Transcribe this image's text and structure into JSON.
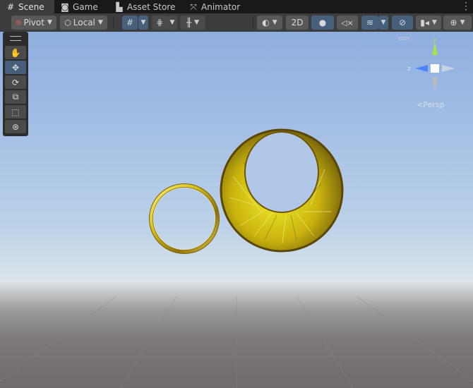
{
  "tabs": [
    {
      "label": "Scene",
      "icon": "grid-icon",
      "active": true
    },
    {
      "label": "Game",
      "icon": "gamepad-icon",
      "active": false
    },
    {
      "label": "Asset Store",
      "icon": "shopping-bag-icon",
      "active": false
    },
    {
      "label": "Animator",
      "icon": "animator-icon",
      "active": false
    }
  ],
  "toolbar": {
    "pivot_label": "Pivot",
    "local_label": "Local",
    "mode_2d_label": "2D"
  },
  "gizmo": {
    "y_label": "y",
    "z_label": "z",
    "projection_label": "<Persp"
  },
  "colors": {
    "accent": "#46607c",
    "gizmo_y": "#a6e24a",
    "gizmo_z": "#4b85ff",
    "ring_gold": "#d4c018"
  }
}
